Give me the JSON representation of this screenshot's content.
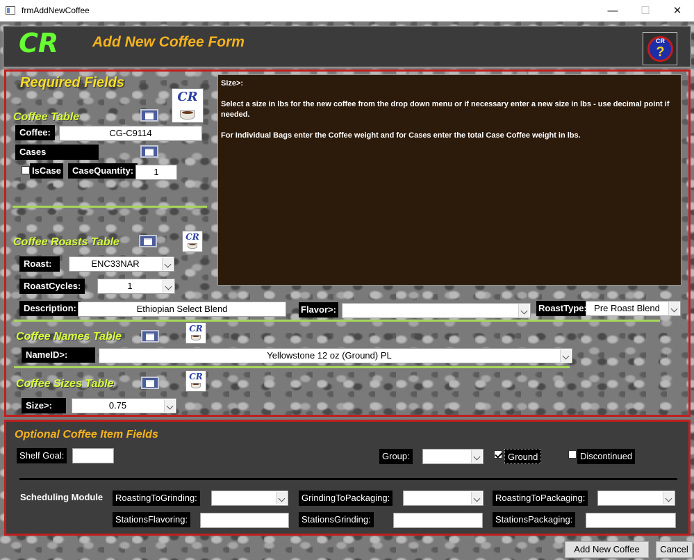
{
  "window": {
    "title": "frmAddNewCoffee",
    "min": "—",
    "max": "☐",
    "close": "✕"
  },
  "header": {
    "logo": "CR",
    "title": "Add New Coffee Form",
    "help_logo": "CR",
    "help_mark": "?"
  },
  "required": {
    "title": "Required Fields",
    "coffee_table": {
      "title": "Coffee Table",
      "coffee_label": "Coffee:",
      "coffee_value": "CG-C9114",
      "cases_label": "Cases",
      "iscase_label": "IsCase",
      "casequantity_label": "CaseQuantity:",
      "casequantity_value": "1"
    },
    "roasts_table": {
      "title": "Coffee Roasts Table",
      "roast_label": "Roast:",
      "roast_value": "ENC33NAR",
      "roastcycles_label": "RoastCycles:",
      "roastcycles_value": "1",
      "description_label": "Description:",
      "description_value": "Ethiopian Select Blend",
      "flavor_label": "Flavor>:",
      "flavor_value": "",
      "roasttype_label": "RoastType:",
      "roasttype_value": "Pre Roast Blend"
    },
    "names_table": {
      "title": "Coffee Names Table",
      "nameid_label": "NameID>:",
      "nameid_value": "Yellowstone 12 oz (Ground) PL"
    },
    "sizes_table": {
      "title": "Coffee Sizes Table",
      "size_label": "Size>:",
      "size_value": "0.75"
    },
    "cr_logo": "CR"
  },
  "help_panel": {
    "heading": "Size>:",
    "p1": "Select a size in lbs for the new coffee from the drop down menu or if necessary enter a new size in lbs - use decimal point if needed.",
    "p2": "For Individual Bags enter the Coffee weight and for Cases enter the total Case Coffee weight in lbs."
  },
  "optional": {
    "title": "Optional Coffee Item Fields",
    "shelfgoal_label": "Shelf Goal:",
    "shelfgoal_value": "",
    "group_label": "Group:",
    "group_value": "",
    "ground_label": "Ground",
    "ground_checked": true,
    "discontinued_label": "Discontinued",
    "discontinued_checked": false,
    "scheduling_label": "Scheduling Module",
    "r2g_label": "RoastingToGrinding:",
    "r2g_value": "",
    "g2p_label": "GrindingToPackaging:",
    "g2p_value": "",
    "r2p_label": "RoastingToPackaging:",
    "r2p_value": "",
    "sf_label": "StationsFlavoring:",
    "sf_value": "",
    "sg_label": "StationsGrinding:",
    "sg_value": "",
    "sp_label": "StationsPackaging:",
    "sp_value": ""
  },
  "buttons": {
    "add": "Add New Coffee",
    "cancel": "Cancel"
  }
}
